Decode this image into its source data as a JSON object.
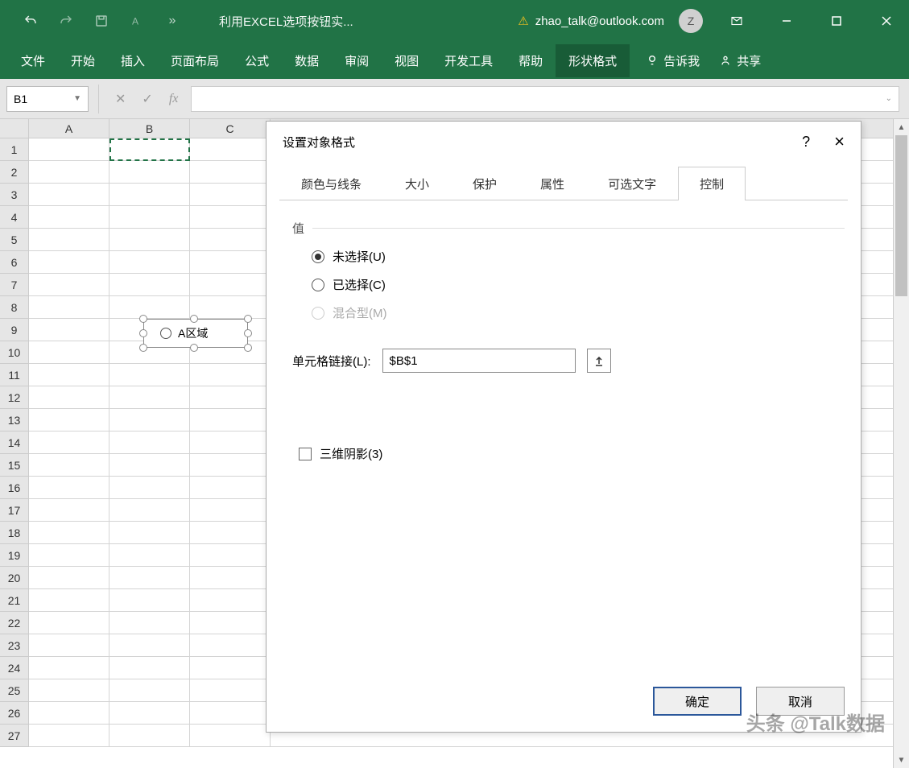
{
  "titlebar": {
    "doc_title": "利用EXCEL选项按钮实...",
    "user_email": "zhao_talk@outlook.com",
    "avatar_initial": "Z"
  },
  "ribbon": {
    "tabs": [
      "文件",
      "开始",
      "插入",
      "页面布局",
      "公式",
      "数据",
      "审阅",
      "视图",
      "开发工具",
      "帮助",
      "形状格式"
    ],
    "active_index": 10,
    "tell_me": "告诉我",
    "share": "共享"
  },
  "fbar": {
    "name_box": "B1"
  },
  "sheet": {
    "columns": [
      "A",
      "B",
      "C"
    ],
    "rows": [
      "1",
      "2",
      "3",
      "4",
      "5",
      "6",
      "7",
      "8",
      "9",
      "10",
      "11",
      "12",
      "13",
      "14",
      "15",
      "16",
      "17",
      "18",
      "19",
      "20",
      "21",
      "22",
      "23",
      "24",
      "25",
      "26",
      "27"
    ],
    "option_control_label": "A区域"
  },
  "dialog": {
    "title": "设置对象格式",
    "tabs": [
      "颜色与线条",
      "大小",
      "保护",
      "属性",
      "可选文字",
      "控制"
    ],
    "active_tab": 5,
    "value_group": "值",
    "radios": {
      "unselected": "未选择(U)",
      "selected": "已选择(C)",
      "mixed": "混合型(M)"
    },
    "cell_link_label": "单元格链接(L):",
    "cell_link_value": "$B$1",
    "shadow3d": "三维阴影(3)",
    "ok": "确定",
    "cancel": "取消",
    "help": "?",
    "close": "×"
  },
  "watermark": "头条 @Talk数据"
}
